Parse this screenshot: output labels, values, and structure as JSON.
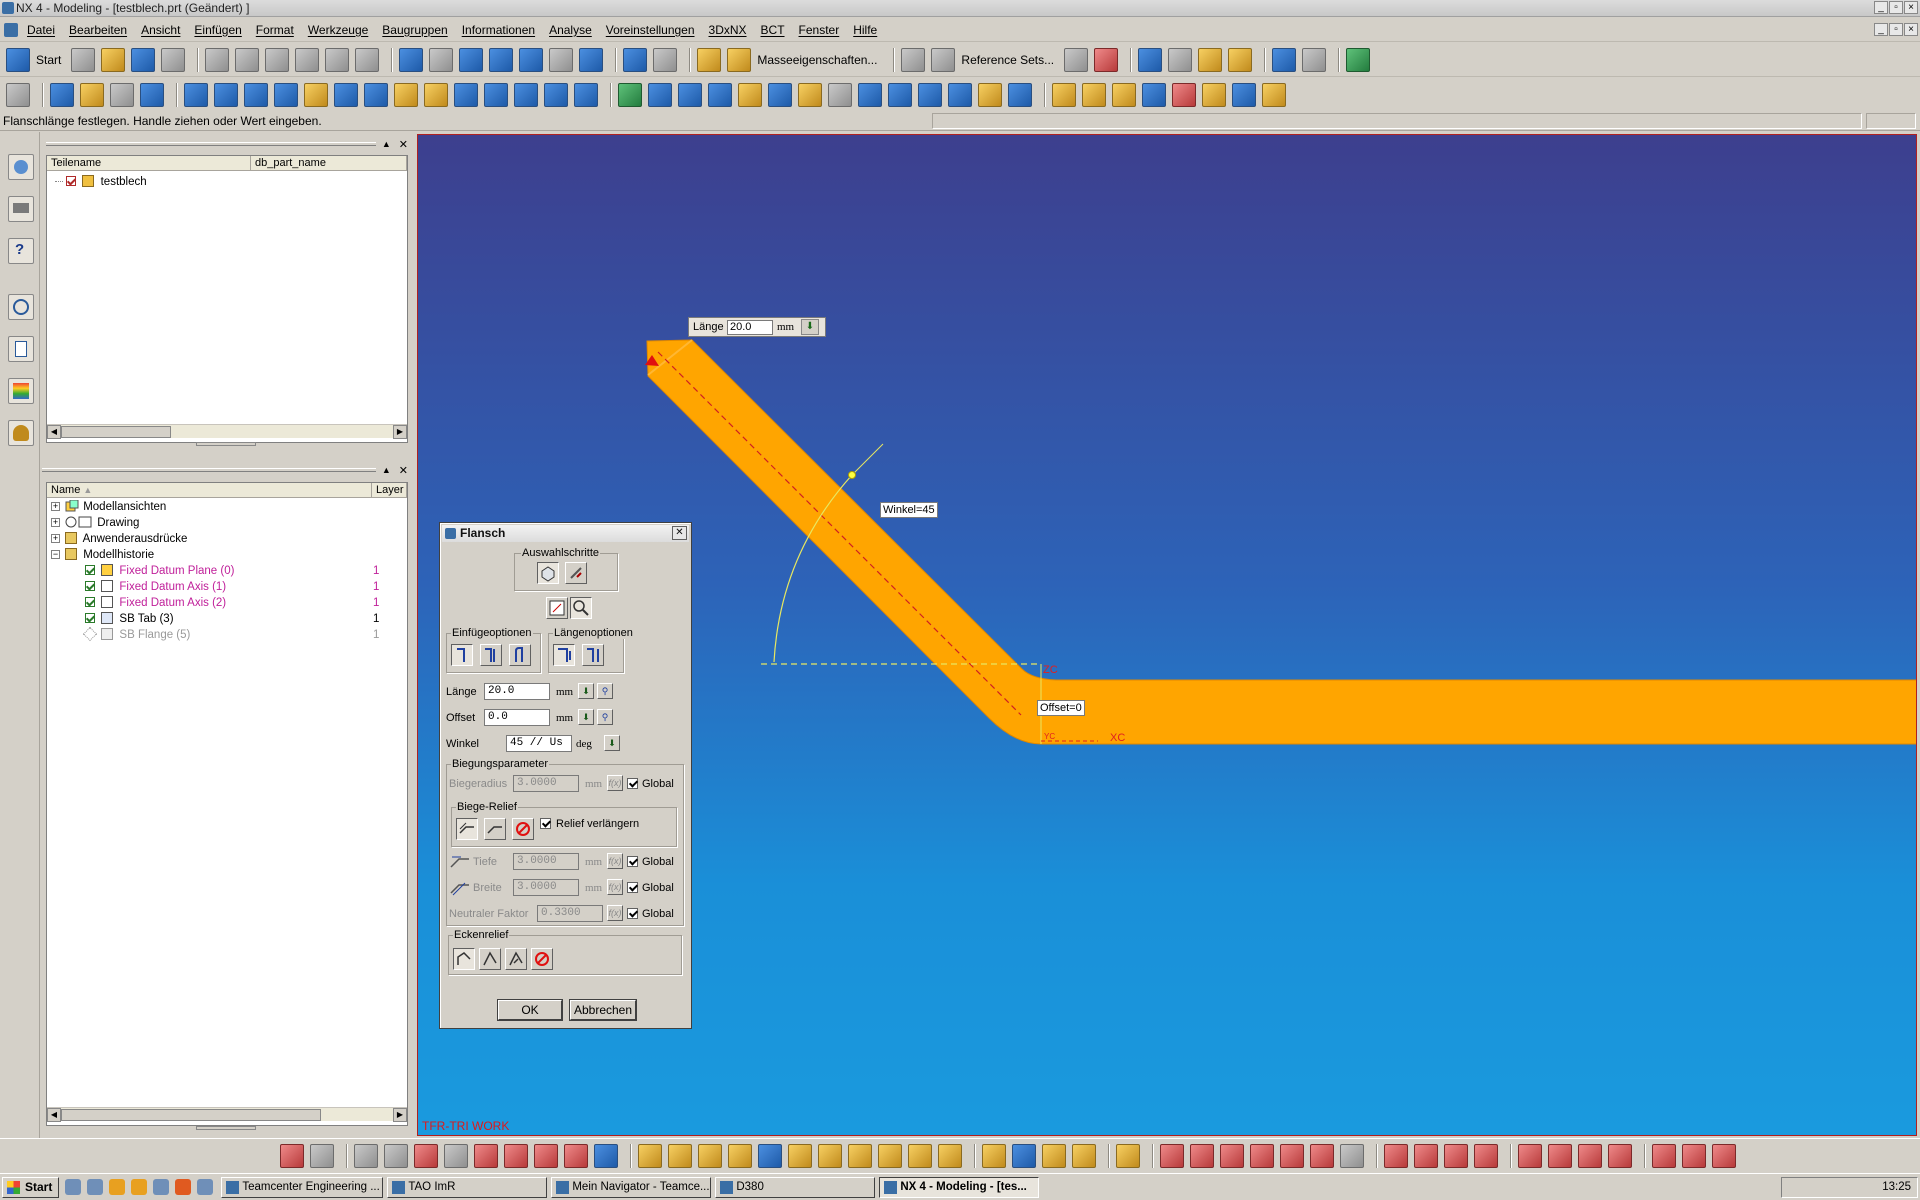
{
  "window": {
    "title": "NX 4 - Modeling - [testblech.prt (Geändert) ]"
  },
  "menu": [
    "Datei",
    "Bearbeiten",
    "Ansicht",
    "Einfügen",
    "Format",
    "Werkzeuge",
    "Baugruppen",
    "Informationen",
    "Analyse",
    "Voreinstellungen",
    "3DxNX",
    "BCT",
    "Fenster",
    "Hilfe"
  ],
  "toolbar1": {
    "start_label": "Start",
    "mass_props_label": "Masseeigenschaften...",
    "ref_sets_label": "Reference Sets..."
  },
  "status_message": "Flanschlänge festlegen. Handle ziehen oder Wert eingeben.",
  "assembly_navigator": {
    "columns": [
      "Teilename",
      "db_part_name"
    ],
    "rows": [
      {
        "name": "testblech"
      }
    ]
  },
  "part_navigator": {
    "columns": [
      "Name",
      "Layer"
    ],
    "rows": [
      {
        "name": "Modellansichten",
        "layer": "",
        "color": "#000000"
      },
      {
        "name": "Drawing",
        "layer": "",
        "color": "#000000"
      },
      {
        "name": "Anwenderausdrücke",
        "layer": "",
        "color": "#000000"
      },
      {
        "name": "Modellhistorie",
        "layer": "",
        "color": "#000000"
      },
      {
        "name": "Fixed Datum Plane (0)",
        "layer": "1",
        "color": "#c0209a"
      },
      {
        "name": "Fixed Datum Axis (1)",
        "layer": "1",
        "color": "#c0209a"
      },
      {
        "name": "Fixed Datum Axis (2)",
        "layer": "1",
        "color": "#c0209a"
      },
      {
        "name": "SB Tab (3)",
        "layer": "1",
        "color": "#000000"
      },
      {
        "name": "SB Flange (5)",
        "layer": "1",
        "color": "#9a9a9a"
      }
    ]
  },
  "viewport": {
    "length_label": "Länge",
    "length_value": "20.0",
    "length_unit": "mm",
    "angle_label": "Winkel=45",
    "offset_label": "Offset=0",
    "axis_zc": "ZC",
    "axis_xc": "XC",
    "axis_yc": "YC",
    "work_label": "TFR-TRI WORK",
    "part_color": "#ffa500"
  },
  "dialog": {
    "title": "Flansch",
    "selection_steps": "Auswahlschritte",
    "insert_options": "Einfügeoptionen",
    "length_options": "Längenoptionen",
    "length_label": "Länge",
    "length_value": "20.0",
    "length_unit": "mm",
    "offset_label": "Offset",
    "offset_value": "0.0",
    "offset_unit": "mm",
    "angle_label": "Winkel",
    "angle_value": "45 // Us",
    "angle_unit": "deg",
    "bend_params": "Biegungsparameter",
    "bend_radius_label": "Biegeradius",
    "bend_radius_value": "3.0000",
    "bend_radius_unit": "mm",
    "global_label": "Global",
    "bend_relief": "Biege-Relief",
    "extend_relief": "Relief verlängern",
    "depth_label": "Tiefe",
    "depth_value": "3.0000",
    "depth_unit": "mm",
    "width_label": "Breite",
    "width_value": "3.0000",
    "width_unit": "mm",
    "neutral_label": "Neutraler Faktor",
    "neutral_value": "0.3300",
    "corner_relief": "Eckenrelief",
    "fx": "f(x)",
    "ok_label": "OK",
    "cancel_label": "Abbrechen"
  },
  "taskbar": {
    "start_label": "Start",
    "tasks": [
      "Teamcenter Engineering ...",
      "TAO ImR",
      "Mein Navigator - Teamce...",
      "D380",
      "NX 4 - Modeling - [tes..."
    ],
    "clock": "13:25"
  }
}
